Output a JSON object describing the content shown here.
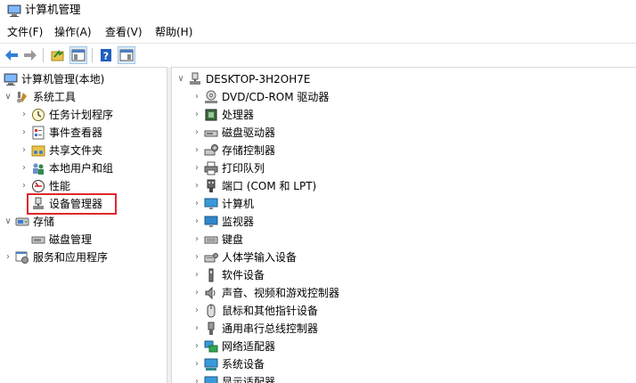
{
  "window": {
    "title": "计算机管理"
  },
  "menu": [
    "文件(F)",
    "操作(A)",
    "查看(V)",
    "帮助(H)"
  ],
  "left_tree": {
    "root": "计算机管理(本地)",
    "system_tools": "系统工具",
    "system_children": [
      "任务计划程序",
      "事件查看器",
      "共享文件夹",
      "本地用户和组",
      "性能",
      "设备管理器"
    ],
    "storage": "存储",
    "storage_children": [
      "磁盘管理"
    ],
    "services": "服务和应用程序"
  },
  "right_tree": {
    "computer": "DESKTOP-3H2OH7E",
    "devices": [
      "DVD/CD-ROM 驱动器",
      "处理器",
      "磁盘驱动器",
      "存储控制器",
      "打印队列",
      "端口 (COM 和 LPT)",
      "计算机",
      "监视器",
      "键盘",
      "人体学输入设备",
      "软件设备",
      "声音、视频和游戏控制器",
      "鼠标和其他指针设备",
      "通用串行总线控制器",
      "网络适配器",
      "系统设备",
      "显示适配器"
    ]
  },
  "highlight_color": "#e0262b"
}
